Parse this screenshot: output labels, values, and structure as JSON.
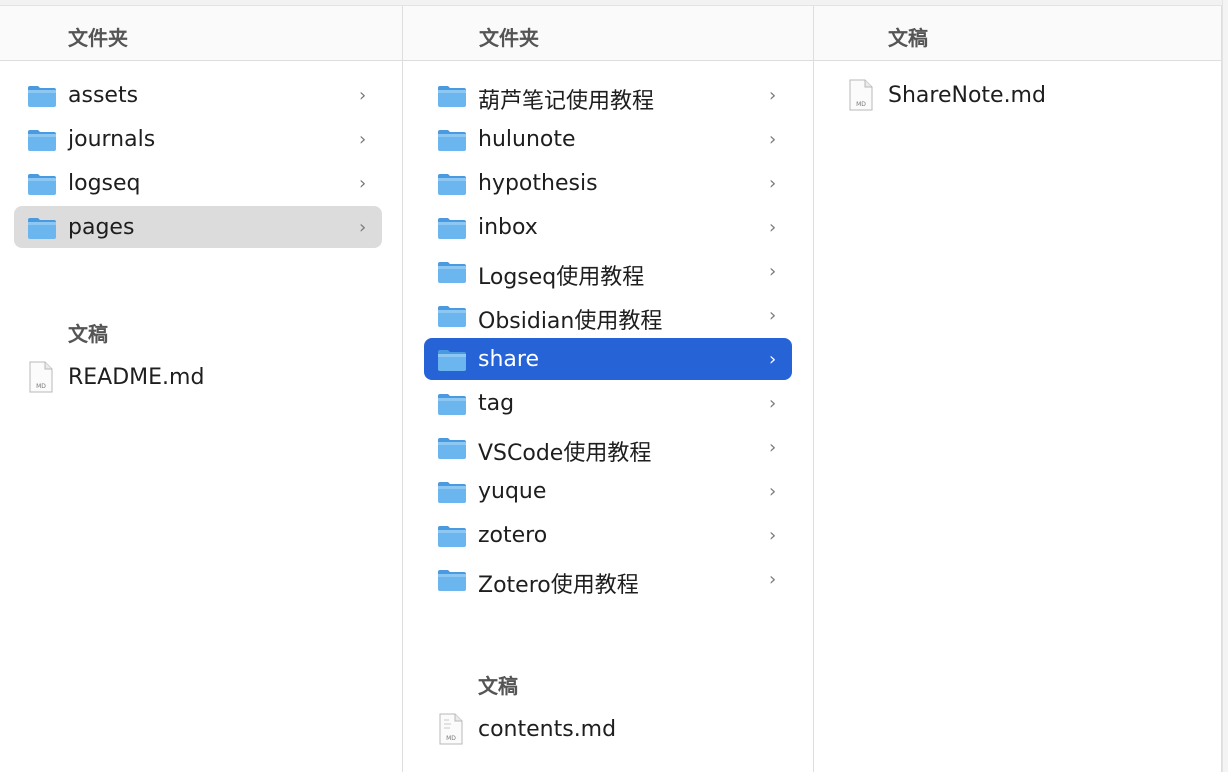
{
  "columns": [
    {
      "header": "文件夹",
      "folders": [
        {
          "name": "assets"
        },
        {
          "name": "journals"
        },
        {
          "name": "logseq"
        },
        {
          "name": "pages"
        }
      ],
      "selected_folder": "pages",
      "docs_label": "文稿",
      "docs": [
        {
          "name": "README.md",
          "badge": "MD"
        }
      ]
    },
    {
      "header": "文件夹",
      "folders": [
        {
          "name": "葫芦笔记使用教程"
        },
        {
          "name": "hulunote"
        },
        {
          "name": "hypothesis"
        },
        {
          "name": "inbox"
        },
        {
          "name": "Logseq使用教程"
        },
        {
          "name": "Obsidian使用教程"
        },
        {
          "name": "share"
        },
        {
          "name": "tag"
        },
        {
          "name": "VSCode使用教程"
        },
        {
          "name": "yuque"
        },
        {
          "name": "zotero"
        },
        {
          "name": "Zotero使用教程"
        }
      ],
      "selected_folder": "share",
      "docs_label": "文稿",
      "docs": [
        {
          "name": "contents.md",
          "badge": "MD"
        }
      ]
    },
    {
      "header": "文稿",
      "docs": [
        {
          "name": "ShareNote.md",
          "badge": "MD"
        }
      ]
    }
  ],
  "icons": {
    "folder": "folder-icon",
    "chevron": "chevron-right-icon",
    "document": "markdown-document-icon",
    "chevron_glyph": "›"
  },
  "colors": {
    "selection_active": "#2563d6",
    "selection_inactive": "#dcdcdc",
    "folder_body": "#6bb6ee",
    "folder_tab": "#4a9ae0"
  }
}
